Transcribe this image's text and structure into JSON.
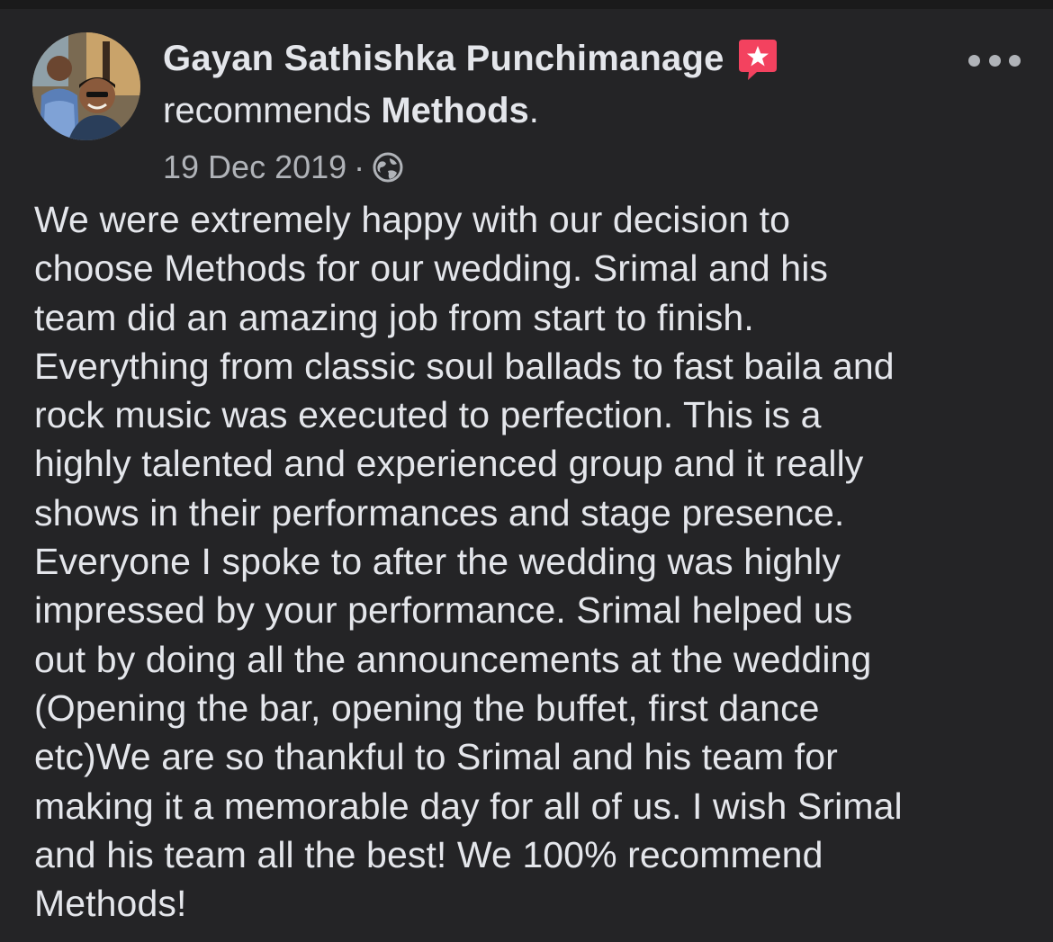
{
  "post": {
    "author": "Gayan Sathishka Punchimanage",
    "recommends_prefix": "recommends ",
    "page_name": "Methods",
    "recommends_suffix": ".",
    "date": "19 Dec 2019",
    "separator": "·",
    "privacy_icon": "globe-icon",
    "badge_icon": "recommendation-star-icon",
    "badge_color": "#f3425f",
    "more_icon": "more-dots-icon",
    "body_lines": [
      "We were extremely happy with our decision to",
      "choose Methods for our wedding. Srimal and his",
      "team did an amazing job from start to finish.",
      "Everything from classic soul ballads to fast baila and",
      "rock music was executed to perfection. This is a",
      "highly talented and experienced group and it really",
      "shows in their performances and stage presence.",
      "Everyone I spoke to after the wedding was highly",
      "impressed by your performance. Srimal helped us",
      "out by doing all the announcements at the wedding",
      "(Opening the bar, opening the buffet, first dance",
      "etc)We are so thankful to Srimal and his team for",
      "making it a memorable day for all of us. I wish Srimal",
      "and his team all the best! We 100% recommend",
      "Methods!"
    ]
  },
  "colors": {
    "background": "#242426",
    "primary_text": "#e4e6eb",
    "secondary_text": "#b0b3b8"
  }
}
